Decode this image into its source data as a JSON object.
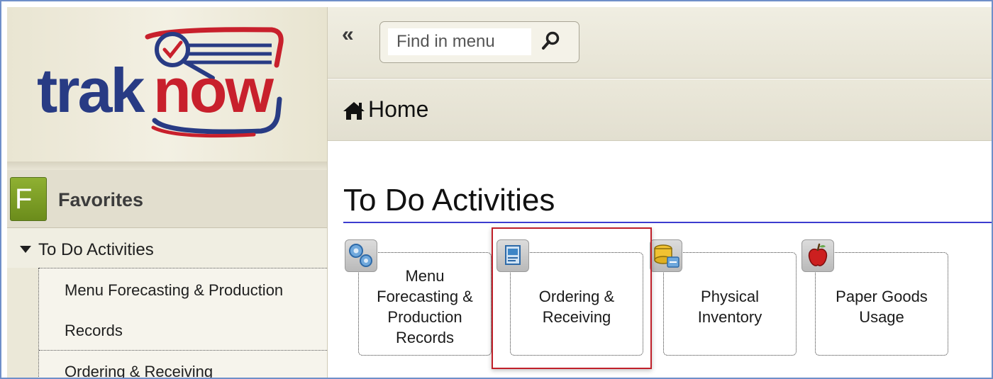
{
  "app": {
    "logo_text": "traknow",
    "brand_colors": {
      "navy": "#283b84",
      "red": "#c8202c",
      "green": "#7a9a23"
    }
  },
  "sidebar": {
    "favorites_badge": "F",
    "favorites_title": "Favorites",
    "group_label": "To Do Activities",
    "items": [
      {
        "label": "Menu Forecasting & Production"
      },
      {
        "label": "Records"
      },
      {
        "label": "Ordering & Receiving"
      }
    ]
  },
  "toolbar": {
    "collapse_glyph": "«",
    "search_placeholder": "Find in menu",
    "search_value": ""
  },
  "breadcrumb": {
    "home_label": "Home"
  },
  "main": {
    "title": "To Do Activities",
    "tiles": [
      {
        "label_lines": [
          "Menu",
          "Forecasting &",
          "Production",
          "Records"
        ],
        "icon": "gears-icon"
      },
      {
        "label_lines": [
          "Ordering &",
          "Receiving"
        ],
        "icon": "order-form-icon",
        "highlighted": true
      },
      {
        "label_lines": [
          "Physical",
          "Inventory"
        ],
        "icon": "coins-database-icon"
      },
      {
        "label_lines": [
          "Paper Goods",
          "Usage"
        ],
        "icon": "apple-icon"
      }
    ],
    "highlight_color": "#c0202a"
  }
}
